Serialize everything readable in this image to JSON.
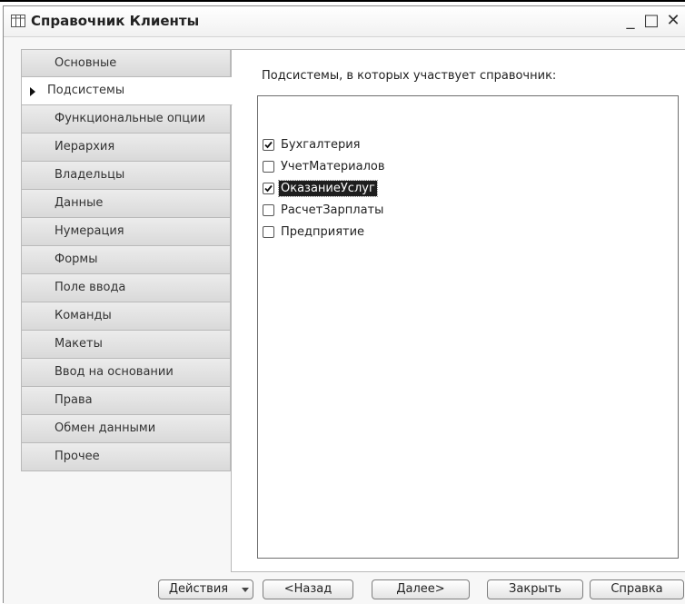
{
  "window": {
    "title": "Справочник Клиенты",
    "controls": {
      "minimize": "_",
      "maximize": "□",
      "close": "✕"
    }
  },
  "tabs": [
    {
      "label": "Основные",
      "active": false
    },
    {
      "label": "Подсистемы",
      "active": true
    },
    {
      "label": "Функциональные опции",
      "active": false
    },
    {
      "label": "Иерархия",
      "active": false
    },
    {
      "label": "Владельцы",
      "active": false
    },
    {
      "label": "Данные",
      "active": false
    },
    {
      "label": "Нумерация",
      "active": false
    },
    {
      "label": "Формы",
      "active": false
    },
    {
      "label": "Поле ввода",
      "active": false
    },
    {
      "label": "Команды",
      "active": false
    },
    {
      "label": "Макеты",
      "active": false
    },
    {
      "label": "Ввод на основании",
      "active": false
    },
    {
      "label": "Права",
      "active": false
    },
    {
      "label": "Обмен данными",
      "active": false
    },
    {
      "label": "Прочее",
      "active": false
    }
  ],
  "panel": {
    "label": "Подсистемы, в которых участвует справочник:",
    "items": [
      {
        "label": "Бухгалтерия",
        "checked": true,
        "selected": false
      },
      {
        "label": "УчетМатериалов",
        "checked": false,
        "selected": false
      },
      {
        "label": "ОказаниеУслуг",
        "checked": true,
        "selected": true
      },
      {
        "label": "РасчетЗарплаты",
        "checked": false,
        "selected": false
      },
      {
        "label": "Предприятие",
        "checked": false,
        "selected": false
      }
    ]
  },
  "footer": {
    "actions": "Действия",
    "back": "<Назад",
    "next": "Далее>",
    "close": "Закрыть",
    "help": "Справка"
  }
}
